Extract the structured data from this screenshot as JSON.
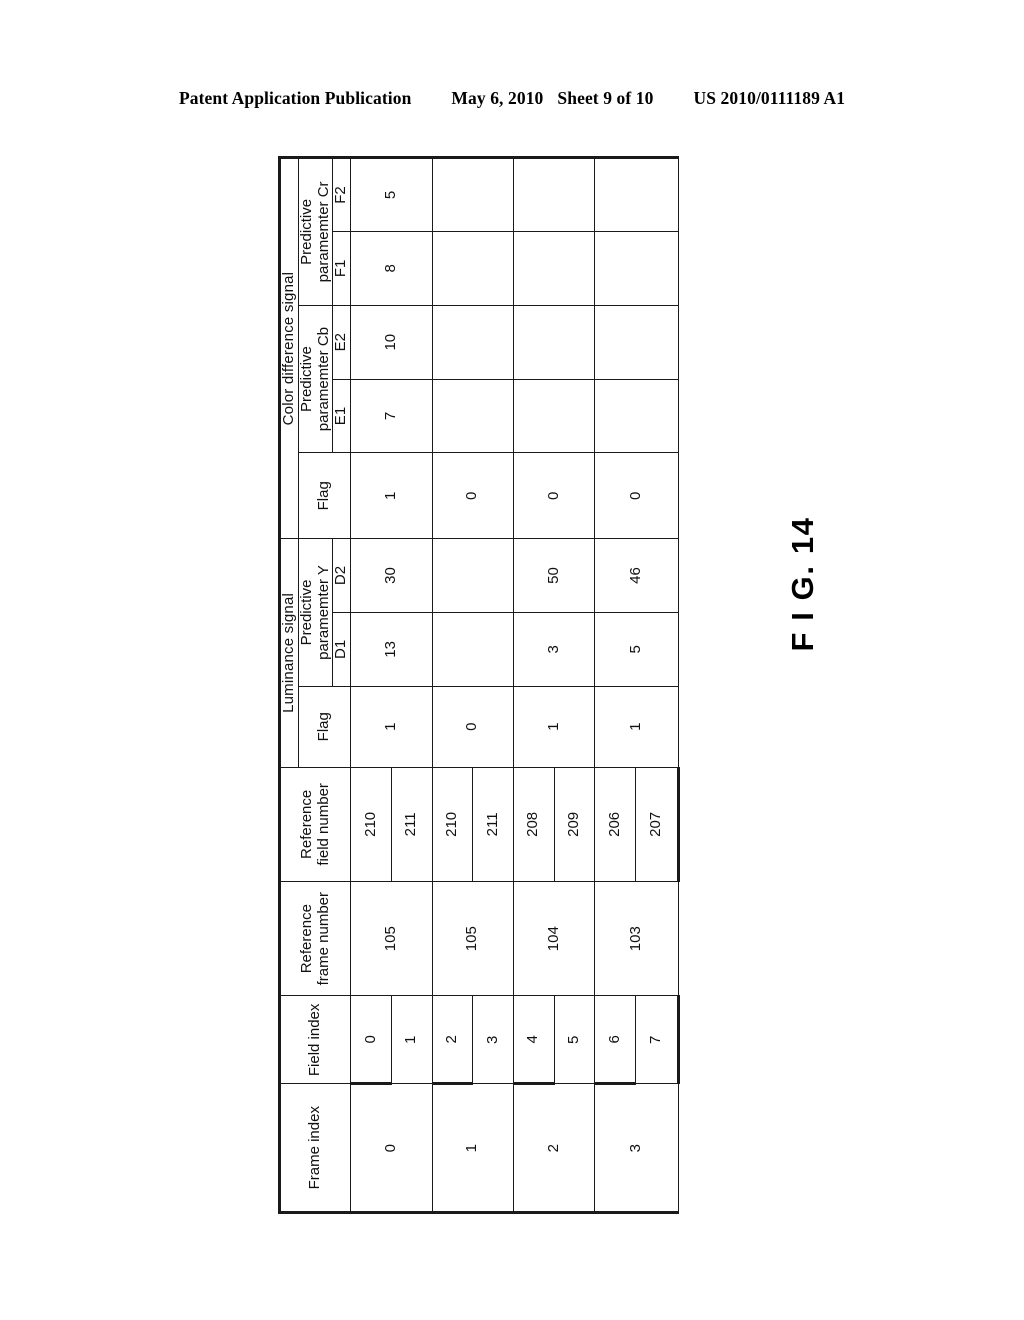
{
  "page_header": {
    "publication": "Patent Application Publication",
    "date": "May 6, 2010",
    "sheet": "Sheet 9 of 10",
    "doc_number": "US 2010/0111189 A1"
  },
  "figure": {
    "caption": "F I G. 14"
  },
  "table": {
    "columns": {
      "frame_index": "Frame index",
      "field_index": "Field index",
      "reference_frame_number": "Reference\nframe number",
      "reference_field_number": "Reference\nfield number",
      "luminance_group": "Luminance signal",
      "luminance_flag": "Flag",
      "luminance_param_group": "Predictive\nparamemter Y",
      "luminance_d1": "D1",
      "luminance_d2": "D2",
      "color_group": "Color difference signal",
      "color_flag": "Flag",
      "color_cb_group": "Predictive\nparamemter Cb",
      "color_e1": "E1",
      "color_e2": "E2",
      "color_cr_group": "Predictive\nparamemter Cr",
      "color_f1": "F1",
      "color_f2": "F2"
    },
    "rows": [
      {
        "frame_index": "0",
        "field_index": [
          "0",
          "1"
        ],
        "reference_frame_number": "105",
        "reference_field_number": [
          "210",
          "211"
        ],
        "luminance_flag": "1",
        "luminance_d1": "13",
        "luminance_d2": "30",
        "color_flag": "1",
        "color_e1": "7",
        "color_e2": "10",
        "color_f1": "8",
        "color_f2": "5"
      },
      {
        "frame_index": "1",
        "field_index": [
          "2",
          "3"
        ],
        "reference_frame_number": "105",
        "reference_field_number": [
          "210",
          "211"
        ],
        "luminance_flag": "0",
        "luminance_d1": "",
        "luminance_d2": "",
        "color_flag": "0",
        "color_e1": "",
        "color_e2": "",
        "color_f1": "",
        "color_f2": ""
      },
      {
        "frame_index": "2",
        "field_index": [
          "4",
          "5"
        ],
        "reference_frame_number": "104",
        "reference_field_number": [
          "208",
          "209"
        ],
        "luminance_flag": "1",
        "luminance_d1": "3",
        "luminance_d2": "50",
        "color_flag": "0",
        "color_e1": "",
        "color_e2": "",
        "color_f1": "",
        "color_f2": ""
      },
      {
        "frame_index": "3",
        "field_index": [
          "6",
          "7"
        ],
        "reference_frame_number": "103",
        "reference_field_number": [
          "206",
          "207"
        ],
        "luminance_flag": "1",
        "luminance_d1": "5",
        "luminance_d2": "46",
        "color_flag": "0",
        "color_e1": "",
        "color_e2": "",
        "color_f1": "",
        "color_f2": ""
      }
    ]
  }
}
